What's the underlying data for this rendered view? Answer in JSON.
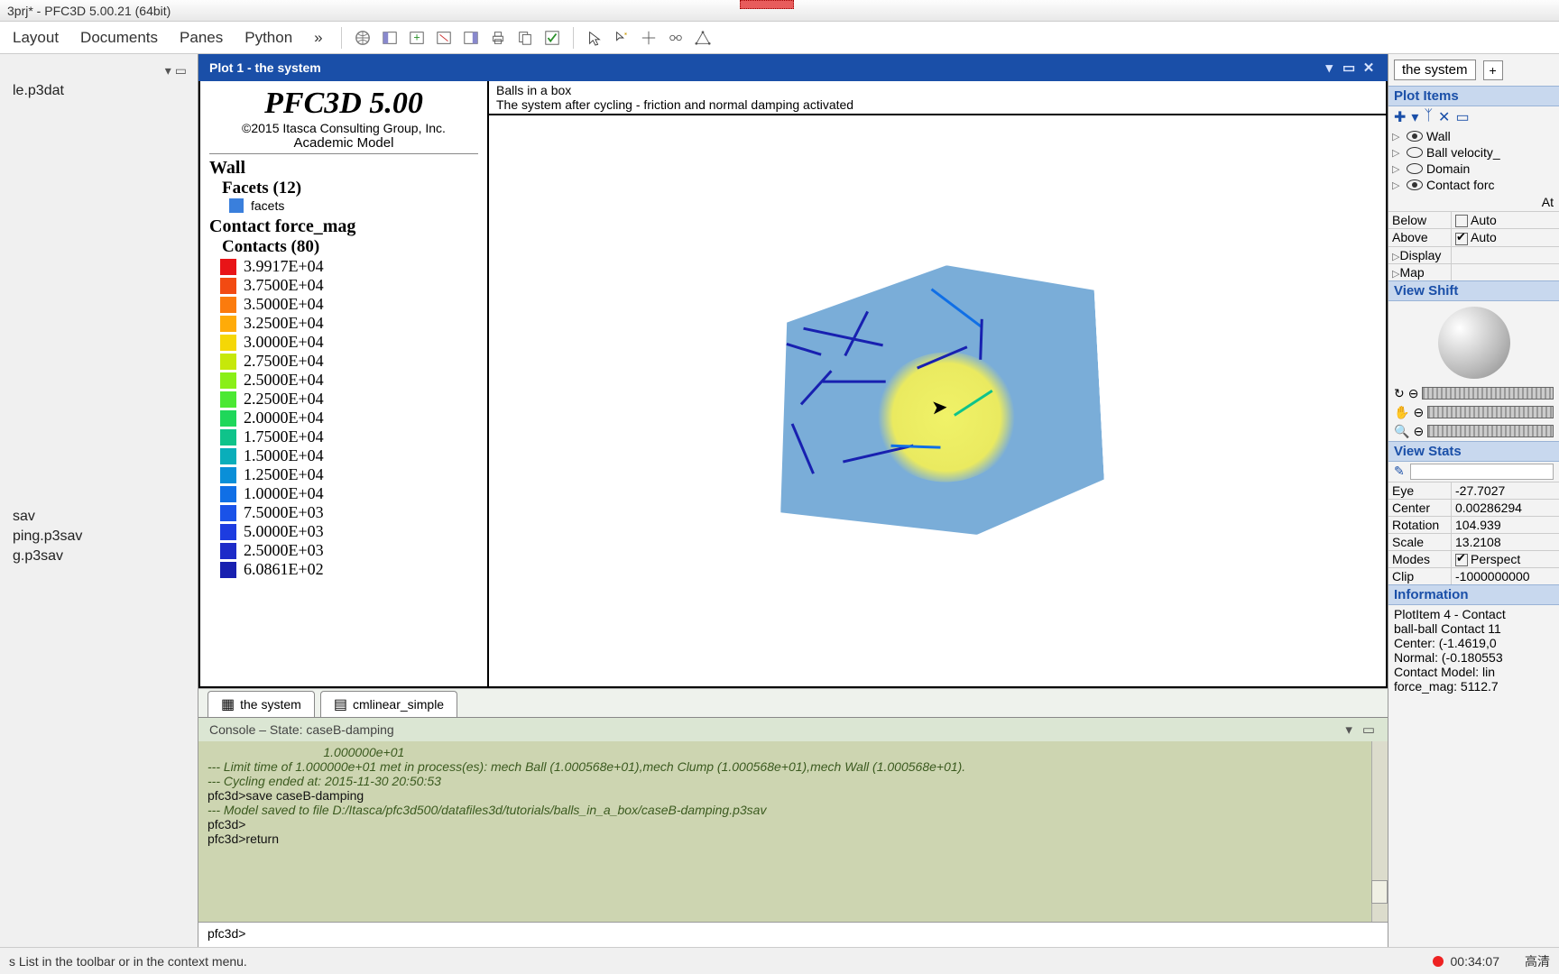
{
  "title": "3prj* - PFC3D 5.00.21 (64bit)",
  "menus": [
    "Layout",
    "Documents",
    "Panes",
    "Python",
    "»"
  ],
  "left_files_top": [
    "le.p3dat"
  ],
  "left_files_bottom": [
    "sav",
    "ping.p3sav",
    "g.p3sav"
  ],
  "plot": {
    "title": "Plot 1 - the system",
    "viz_title": "Balls in a box",
    "viz_sub": "The system after cycling - friction and normal damping activated"
  },
  "legend": {
    "prod": "PFC3D 5.00",
    "copyright": "©2015 Itasca Consulting Group, Inc.",
    "academic": "Academic Model",
    "wall_hdr": "Wall",
    "facets_hdr": "Facets (12)",
    "facets_label": "facets",
    "facets_color": "#3a7fdc",
    "cfm_hdr": "Contact force_mag",
    "contacts_hdr": "Contacts (80)",
    "scale": [
      {
        "c": "#e81417",
        "v": "3.9917E+04"
      },
      {
        "c": "#f24a12",
        "v": "3.7500E+04"
      },
      {
        "c": "#fb7b0d",
        "v": "3.5000E+04"
      },
      {
        "c": "#ffab08",
        "v": "3.2500E+04"
      },
      {
        "c": "#f5d706",
        "v": "3.0000E+04"
      },
      {
        "c": "#c6e80a",
        "v": "2.7500E+04"
      },
      {
        "c": "#8aef18",
        "v": "2.5000E+04"
      },
      {
        "c": "#4be833",
        "v": "2.2500E+04"
      },
      {
        "c": "#1fd75a",
        "v": "2.0000E+04"
      },
      {
        "c": "#0fc38a",
        "v": "1.7500E+04"
      },
      {
        "c": "#0aaeba",
        "v": "1.5000E+04"
      },
      {
        "c": "#0a8fd8",
        "v": "1.2500E+04"
      },
      {
        "c": "#106fe6",
        "v": "1.0000E+04"
      },
      {
        "c": "#1a52e8",
        "v": "7.5000E+03"
      },
      {
        "c": "#1d3ce0",
        "v": "5.0000E+03"
      },
      {
        "c": "#1d2bc8",
        "v": "2.5000E+03"
      },
      {
        "c": "#1820b0",
        "v": "6.0861E+02"
      }
    ]
  },
  "tabs": [
    "the system",
    "cmlinear_simple"
  ],
  "console": {
    "title": "Console – State: caseB-damping",
    "lines": [
      {
        "cls": "",
        "t": "                                 1.000000e+01"
      },
      {
        "cls": "",
        "t": "--- Limit time of 1.000000e+01 met in process(es): mech Ball (1.000568e+01),mech Clump (1.000568e+01),mech Wall (1.000568e+01)."
      },
      {
        "cls": "",
        "t": "--- Cycling ended at: 2015-11-30 20:50:53"
      },
      {
        "cls": "black",
        "t": "pfc3d>save caseB-damping"
      },
      {
        "cls": "",
        "t": "--- Model saved to file D:/Itasca/pfc3d500/datafiles3d/tutorials/balls_in_a_box/caseB-damping.p3sav"
      },
      {
        "cls": "black",
        "t": "pfc3d>"
      },
      {
        "cls": "black",
        "t": "pfc3d>return"
      }
    ],
    "prompt": "pfc3d>"
  },
  "right": {
    "tab": "the system",
    "plot_items_hdr": "Plot Items",
    "items": [
      {
        "label": "Wall",
        "on": true
      },
      {
        "label": "Ball velocity_",
        "on": false
      },
      {
        "label": "Domain",
        "on": false
      },
      {
        "label": "Contact forc",
        "on": true
      }
    ],
    "props_check": [
      {
        "k": "Below",
        "v": "Auto"
      },
      {
        "k": "Above",
        "v": "Auto",
        "chk": true
      }
    ],
    "props_plain": [
      {
        "k": "Display",
        "v": ""
      },
      {
        "k": "Map",
        "v": ""
      }
    ],
    "view_shift": "View Shift",
    "sliders": [
      "↻⊖",
      "✋⊖",
      "🔍⊖"
    ],
    "view_stats_hdr": "View Stats",
    "stats": [
      {
        "k": "Eye",
        "v": "-27.7027"
      },
      {
        "k": "Center",
        "v": "0.00286294"
      },
      {
        "k": "Rotation",
        "v": "104.939"
      },
      {
        "k": "Scale",
        "v": "13.2108"
      },
      {
        "k": "Modes",
        "v": "Perspect",
        "chk": true
      },
      {
        "k": "Clip",
        "v": "-1000000000"
      }
    ],
    "info_hdr": "Information",
    "info_lines": [
      "PlotItem 4 - Contact",
      "ball-ball Contact 11",
      "  Center: (-1.4619,0",
      "  Normal: (-0.180553",
      "  Contact Model: lin",
      "  force_mag: 5112.7"
    ]
  },
  "status_left": "s List in the toolbar or in the context menu.",
  "status_time": "00:34:07",
  "status_hd": "高清"
}
